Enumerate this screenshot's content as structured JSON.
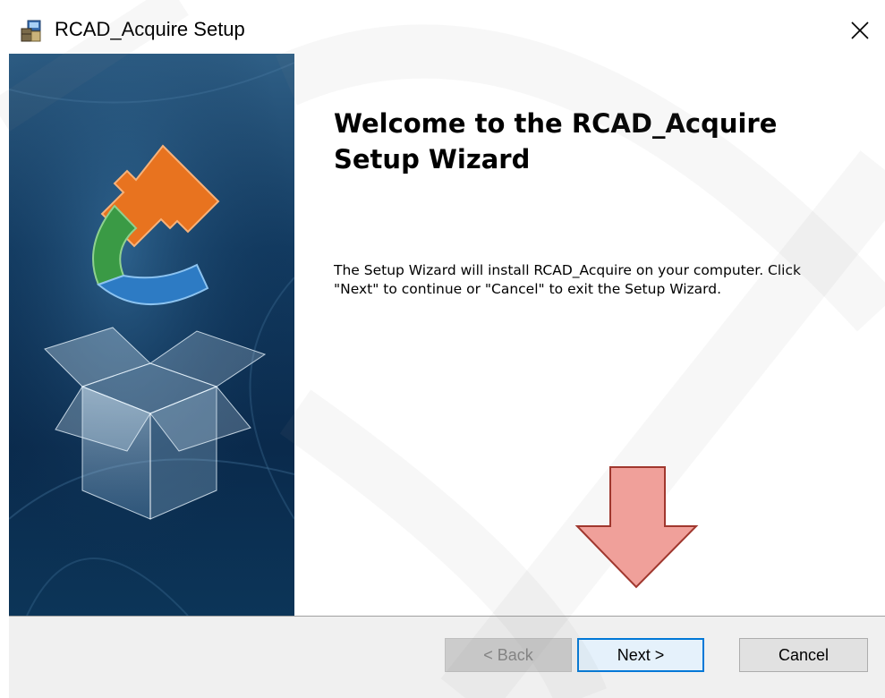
{
  "window": {
    "title": "RCAD_Acquire Setup",
    "icons": {
      "app": "installer-icon",
      "close": "close-icon"
    }
  },
  "wizard": {
    "heading": "Welcome to the RCAD_Acquire Setup Wizard",
    "body": "The Setup Wizard will install RCAD_Acquire on your computer.  Click \"Next\" to continue or \"Cancel\" to exit the Setup Wizard.",
    "side_graphic": "open-box-with-puzzle-logo"
  },
  "footer": {
    "back_label": "< Back",
    "back_enabled": false,
    "next_label": "Next >",
    "cancel_label": "Cancel"
  },
  "overlay": {
    "annotation": "down-arrow-pointing-at-next",
    "arrow_color": "#f0a09a",
    "arrow_outline": "#a0372e"
  },
  "colors": {
    "focus_border": "#0078d7",
    "footer_bg": "#f0f0f0",
    "panel_dark": "#0b2a4a"
  }
}
